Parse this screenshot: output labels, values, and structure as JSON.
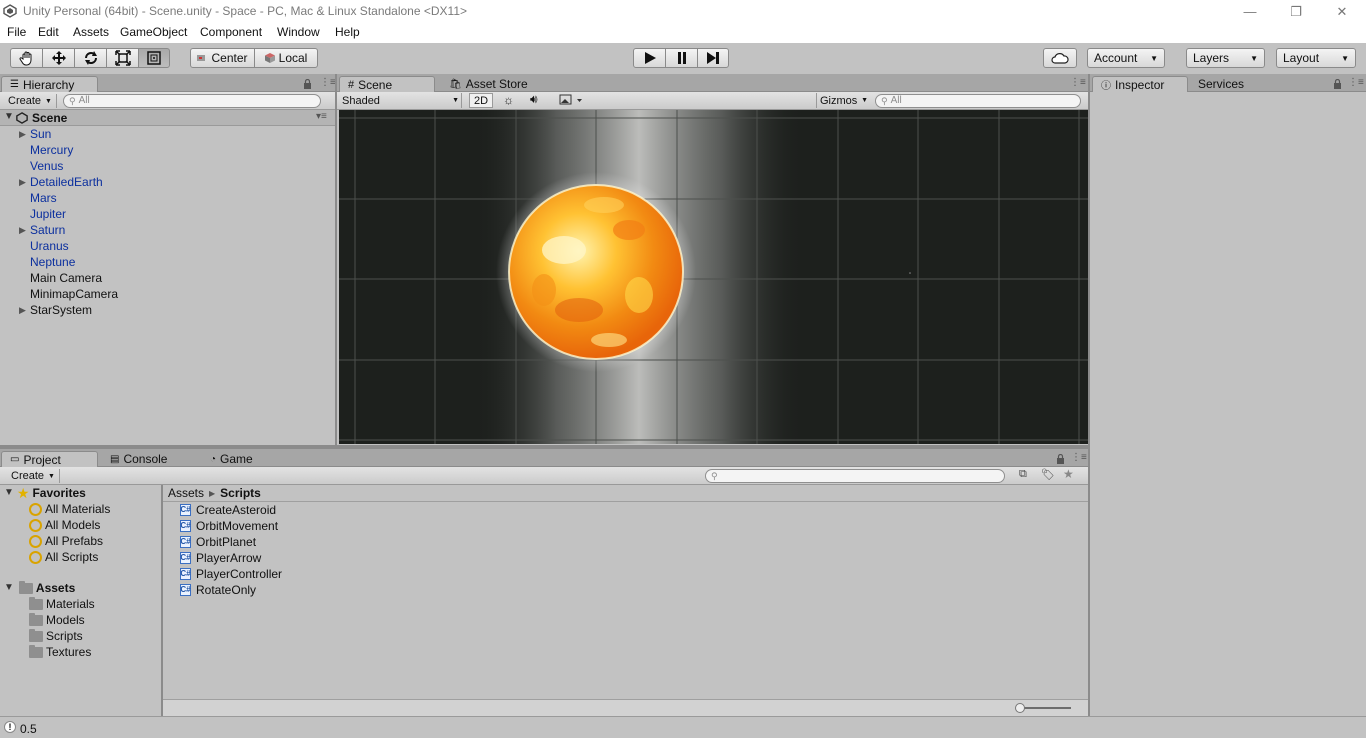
{
  "window": {
    "title": "Unity Personal (64bit) - Scene.unity - Space - PC, Mac & Linux Standalone <DX11>",
    "controls": [
      "—",
      "❐",
      "✕"
    ]
  },
  "menu": [
    "File",
    "Edit",
    "Assets",
    "GameObject",
    "Component",
    "Window",
    "Help"
  ],
  "toolbar": {
    "pivot_label": "Center",
    "space_label": "Local",
    "account_label": "Account",
    "layers_label": "Layers",
    "layout_label": "Layout"
  },
  "hierarchy": {
    "tab_label": "Hierarchy",
    "create_label": "Create",
    "search_placeholder": "All",
    "scene_name": "Scene",
    "items": [
      {
        "label": "Sun",
        "expandable": true,
        "prefab": true
      },
      {
        "label": "Mercury",
        "expandable": false,
        "prefab": true
      },
      {
        "label": "Venus",
        "expandable": false,
        "prefab": true
      },
      {
        "label": "DetailedEarth",
        "expandable": true,
        "prefab": true
      },
      {
        "label": "Mars",
        "expandable": false,
        "prefab": true
      },
      {
        "label": "Jupiter",
        "expandable": false,
        "prefab": true
      },
      {
        "label": "Saturn",
        "expandable": true,
        "prefab": true
      },
      {
        "label": "Uranus",
        "expandable": false,
        "prefab": true
      },
      {
        "label": "Neptune",
        "expandable": false,
        "prefab": true
      },
      {
        "label": "Main Camera",
        "expandable": false,
        "prefab": false
      },
      {
        "label": "MinimapCamera",
        "expandable": false,
        "prefab": false
      },
      {
        "label": "StarSystem",
        "expandable": true,
        "prefab": false
      }
    ]
  },
  "scene": {
    "tabs": [
      "Scene",
      "Asset Store"
    ],
    "shading": "Shaded",
    "mode_2d": "2D",
    "gizmos_label": "Gizmos",
    "search_placeholder": "All"
  },
  "inspector": {
    "tabs": [
      "Inspector",
      "Services"
    ]
  },
  "project": {
    "tabs": [
      "Project",
      "Console",
      "Game"
    ],
    "create_label": "Create",
    "favorites_label": "Favorites",
    "favorites": [
      "All Materials",
      "All Models",
      "All Prefabs",
      "All Scripts"
    ],
    "assets_label": "Assets",
    "asset_folders": [
      "Materials",
      "Models",
      "Scripts",
      "Textures"
    ],
    "breadcrumb": [
      "Assets",
      "Scripts"
    ],
    "scripts": [
      "CreateAsteroid",
      "OrbitMovement",
      "OrbitPlanet",
      "PlayerArrow",
      "PlayerController",
      "RotateOnly"
    ]
  },
  "status": {
    "message": "0.5"
  },
  "colors": {
    "prefab_text": "#0b2f9e",
    "panel_bg": "#c2c2c2",
    "scene_bg": "#1c1f1c"
  }
}
